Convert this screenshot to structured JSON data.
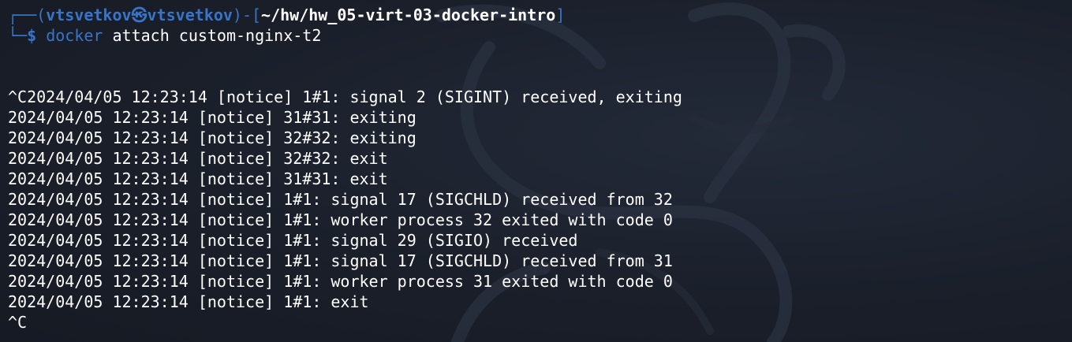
{
  "prompt": {
    "frame_top_left": "┌──(",
    "user": "vtsvetkov",
    "separator": "㉿",
    "host": "vtsvetkov",
    "frame_mid": ")-[",
    "cwd": "~/hw/hw_05-virt-03-docker-intro",
    "frame_close": "]",
    "frame_bottom_left": "└─",
    "prompt_symbol": "$",
    "command_name": "docker",
    "command_args": "attach custom-nginx-t2"
  },
  "output": {
    "lines": [
      "",
      "",
      "^C2024/04/05 12:23:14 [notice] 1#1: signal 2 (SIGINT) received, exiting",
      "2024/04/05 12:23:14 [notice] 31#31: exiting",
      "2024/04/05 12:23:14 [notice] 32#32: exiting",
      "2024/04/05 12:23:14 [notice] 32#32: exit",
      "2024/04/05 12:23:14 [notice] 31#31: exit",
      "2024/04/05 12:23:14 [notice] 1#1: signal 17 (SIGCHLD) received from 32",
      "2024/04/05 12:23:14 [notice] 1#1: worker process 32 exited with code 0",
      "2024/04/05 12:23:14 [notice] 1#1: signal 29 (SIGIO) received",
      "2024/04/05 12:23:14 [notice] 1#1: signal 17 (SIGCHLD) received from 31",
      "2024/04/05 12:23:14 [notice] 1#1: worker process 31 exited with code 0",
      "2024/04/05 12:23:14 [notice] 1#1: exit",
      "^C"
    ]
  },
  "colors": {
    "background": "#1a1f2a",
    "accent_blue": "#3874c7",
    "text": "#ffffff"
  },
  "icons": {
    "watermark": "kali-dragon-watermark-icon"
  }
}
